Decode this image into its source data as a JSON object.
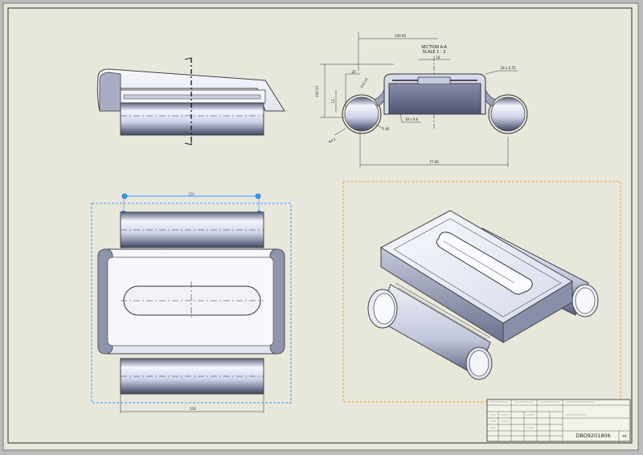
{
  "colors": {
    "sheet": "#e8e7dc",
    "frame": "#2b2b2b",
    "selection": "#3399ff",
    "active_view": "#f0a040",
    "metal_light": "#e9ecf7",
    "metal_dark": "#5a5e78"
  },
  "views": {
    "side": {
      "name": "side-view"
    },
    "section": {
      "caption_line1": "SECTION A-A",
      "caption_line2": "SCALE 1 : 2",
      "dim_top": "100.00",
      "dim_small_top": "18",
      "dim_left_a": "20",
      "dim_left_b": "13",
      "dim_left_c": "103.13",
      "dim_vertical": "100.13",
      "dim_radius_left": "R4.5",
      "dim_thick_left": "1.60",
      "dim_thick_inner": "18 x 0.6",
      "dim_thick_right": "18 x 0.75",
      "dim_bottom": "7.95",
      "dim_total": "77.00",
      "dim_angle": "45°"
    },
    "top": {
      "dim_top": "120",
      "dim_bottom": "120"
    },
    "iso": {
      "name": "isometric-view"
    }
  },
  "title_block": {
    "drawing_number": "DBD9201806",
    "sheet": "A4"
  }
}
